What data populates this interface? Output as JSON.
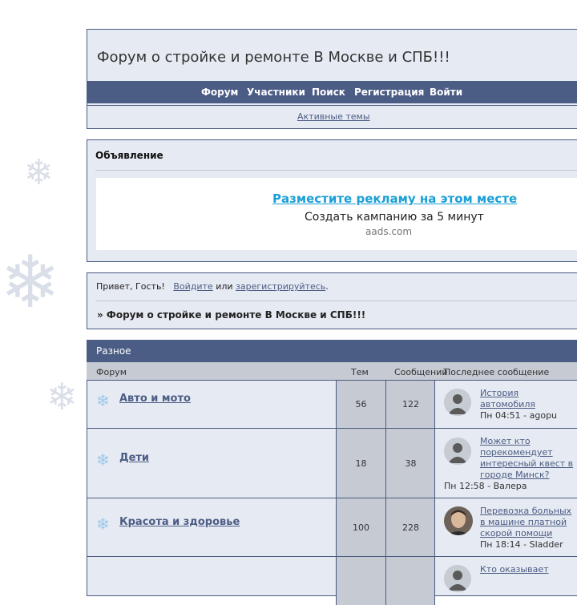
{
  "site_title": "Форум о стройке и ремонте В Москве и СПБ!!!",
  "nav": {
    "forum": "Форум",
    "members": "Участники",
    "search": "Поиск",
    "register": "Регистрация",
    "login": "Войти"
  },
  "active_topics": "Активные темы",
  "announcement": {
    "title": "Объявление",
    "ad_link": "Разместите рекламу на этом месте",
    "ad_sub": "Создать кампанию за 5 минут",
    "ad_domain": "aads.com"
  },
  "greeting": {
    "hello": "Привет, Гость!",
    "login": "Войдите",
    "or": "или",
    "register": "зарегистрируйтесь",
    "dot": "."
  },
  "breadcrumb": "» Форум о стройке и ремонте В Москве и СПБ!!!",
  "section": {
    "title": "Разное",
    "columns": {
      "forum": "Форум",
      "topics": "Тем",
      "posts": "Сообщений",
      "last": "Последнее сообщение"
    },
    "forums": [
      {
        "name": "Авто и мото",
        "topics": "56",
        "posts": "122",
        "last_title": "История автомобиля",
        "last_meta": "Пн 04:51 - agopu"
      },
      {
        "name": "Дети",
        "topics": "18",
        "posts": "38",
        "last_title": "Может кто порекомендует интересный квест в городе Минск?",
        "last_meta": "Пн 12:58 - Валера"
      },
      {
        "name": "Красота и здоровье",
        "topics": "100",
        "posts": "228",
        "last_title": "Перевозка больных в машине платной скорой помощи",
        "last_meta": "Пн 18:14 - Sladder"
      },
      {
        "name": "",
        "topics": "",
        "posts": "",
        "last_title": "Кто оказывает",
        "last_meta": ""
      }
    ]
  },
  "icons": {
    "snowflake": "snowflake-icon",
    "avatar": "user-avatar-icon"
  },
  "colors": {
    "nav_bg": "#4b5c85",
    "panel_bg": "#e6eaf2",
    "column_bg": "#c6cad3",
    "link": "#4b5c85",
    "ad_link": "#1a9fd6"
  }
}
